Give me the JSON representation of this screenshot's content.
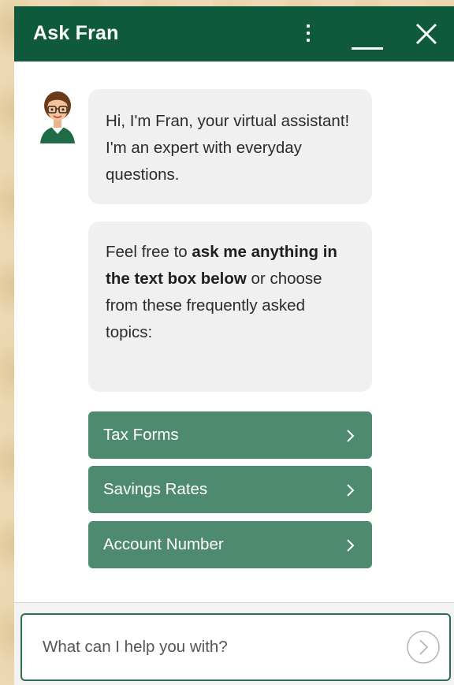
{
  "header": {
    "title": "Ask Fran",
    "menu_icon": "kebab-menu-icon",
    "minimize_icon": "minimize-icon",
    "close_icon": "close-icon",
    "bg_color": "#0f5a3c"
  },
  "assistant": {
    "avatar_icon": "fran-avatar"
  },
  "messages": [
    {
      "text": "Hi, I'm Fran, your virtual assistant! I'm an expert with everyday questions."
    },
    {
      "text_before": "Feel free to ",
      "text_bold": "ask me anything in the text box below",
      "text_after": " or choose from these frequently asked topics:"
    }
  ],
  "topics": [
    {
      "label": "Tax Forms"
    },
    {
      "label": "Savings Rates"
    },
    {
      "label": "Account Number"
    }
  ],
  "topic_color": "#4e8a70",
  "input": {
    "placeholder": "What can I help you with?",
    "value": "",
    "send_icon": "send-arrow-icon"
  }
}
